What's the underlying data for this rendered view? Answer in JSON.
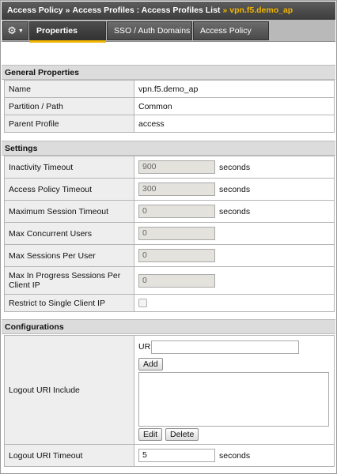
{
  "breadcrumb": {
    "items": [
      "Access Policy",
      "Access Profiles : Access Profiles List"
    ],
    "separator": "»",
    "current": "vpn.f5.demo_ap"
  },
  "tabs": {
    "gear_icon": "gear-icon",
    "items": [
      {
        "label": "Properties",
        "active": true
      },
      {
        "label": "SSO / Auth Domains",
        "active": false
      },
      {
        "label": "Access Policy",
        "active": false
      }
    ]
  },
  "general": {
    "title": "General Properties",
    "rows": [
      {
        "label": "Name",
        "value": "vpn.f5.demo_ap"
      },
      {
        "label": "Partition / Path",
        "value": "Common"
      },
      {
        "label": "Parent Profile",
        "value": "access"
      }
    ]
  },
  "settings": {
    "title": "Settings",
    "rows": [
      {
        "label": "Inactivity Timeout",
        "value": "900",
        "unit": "seconds"
      },
      {
        "label": "Access Policy Timeout",
        "value": "300",
        "unit": "seconds"
      },
      {
        "label": "Maximum Session Timeout",
        "value": "0",
        "unit": "seconds"
      },
      {
        "label": "Max Concurrent Users",
        "value": "0"
      },
      {
        "label": "Max Sessions Per User",
        "value": "0"
      },
      {
        "label": "Max In Progress Sessions Per Client IP",
        "value": "0"
      },
      {
        "label": "Restrict to Single Client IP",
        "checked": false
      }
    ]
  },
  "configurations": {
    "title": "Configurations",
    "logout_uri_include": {
      "label": "Logout URI Include",
      "uri_label": "URI",
      "uri_value": "",
      "add_label": "Add",
      "edit_label": "Edit",
      "delete_label": "Delete"
    },
    "logout_uri_timeout": {
      "label": "Logout URI Timeout",
      "value": "5",
      "unit": "seconds"
    }
  },
  "colors": {
    "header_bg": "#4a4a4a",
    "accent": "#f0b400",
    "section_bg": "#dcdcdc",
    "label_bg": "#eeeeee"
  }
}
